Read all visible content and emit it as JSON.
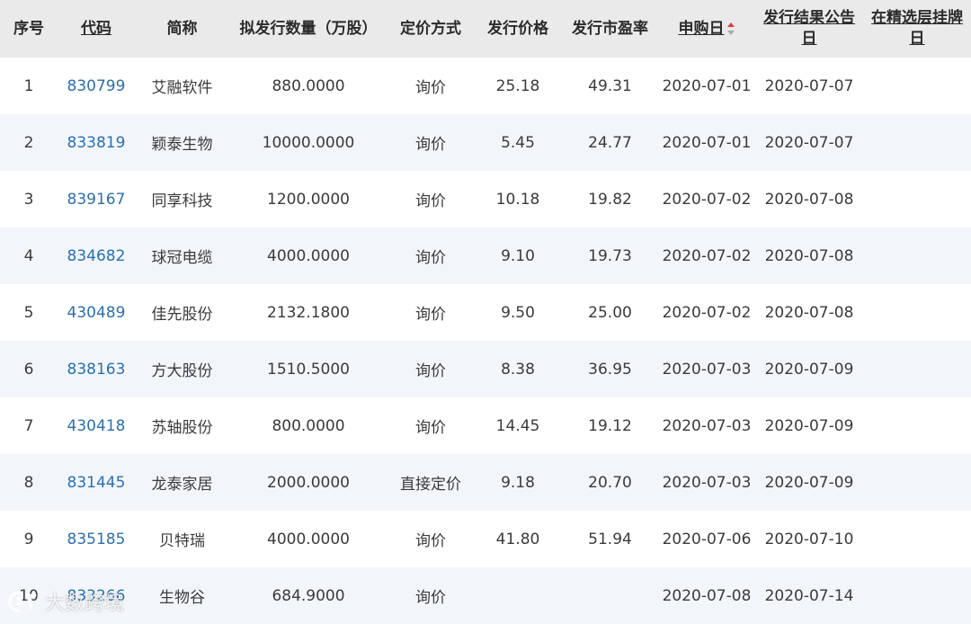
{
  "columns": {
    "seq": "序号",
    "code": "代码",
    "name": "简称",
    "quantity": "拟发行数量（万股）",
    "pricing_method": "定价方式",
    "price": "发行价格",
    "pe": "发行市盈率",
    "subscribe_date": "申购日",
    "result_date": "发行结果公告日",
    "listing_date": "在精选层挂牌日"
  },
  "sort": {
    "column": "subscribe_date",
    "direction": "ascending",
    "active_color": "#e03c3c",
    "inactive_color": "#aaaaaa"
  },
  "rows": [
    {
      "seq": "1",
      "code": "830799",
      "name": "艾融软件",
      "quantity": "880.0000",
      "method": "询价",
      "price": "25.18",
      "pe": "49.31",
      "subscribe": "2020-07-01",
      "result": "2020-07-07",
      "listing": ""
    },
    {
      "seq": "2",
      "code": "833819",
      "name": "颖泰生物",
      "quantity": "10000.0000",
      "method": "询价",
      "price": "5.45",
      "pe": "24.77",
      "subscribe": "2020-07-01",
      "result": "2020-07-07",
      "listing": ""
    },
    {
      "seq": "3",
      "code": "839167",
      "name": "同享科技",
      "quantity": "1200.0000",
      "method": "询价",
      "price": "10.18",
      "pe": "19.82",
      "subscribe": "2020-07-02",
      "result": "2020-07-08",
      "listing": ""
    },
    {
      "seq": "4",
      "code": "834682",
      "name": "球冠电缆",
      "quantity": "4000.0000",
      "method": "询价",
      "price": "9.10",
      "pe": "19.73",
      "subscribe": "2020-07-02",
      "result": "2020-07-08",
      "listing": ""
    },
    {
      "seq": "5",
      "code": "430489",
      "name": "佳先股份",
      "quantity": "2132.1800",
      "method": "询价",
      "price": "9.50",
      "pe": "25.00",
      "subscribe": "2020-07-02",
      "result": "2020-07-08",
      "listing": ""
    },
    {
      "seq": "6",
      "code": "838163",
      "name": "方大股份",
      "quantity": "1510.5000",
      "method": "询价",
      "price": "8.38",
      "pe": "36.95",
      "subscribe": "2020-07-03",
      "result": "2020-07-09",
      "listing": ""
    },
    {
      "seq": "7",
      "code": "430418",
      "name": "苏轴股份",
      "quantity": "800.0000",
      "method": "询价",
      "price": "14.45",
      "pe": "19.12",
      "subscribe": "2020-07-03",
      "result": "2020-07-09",
      "listing": ""
    },
    {
      "seq": "8",
      "code": "831445",
      "name": "龙泰家居",
      "quantity": "2000.0000",
      "method": "直接定价",
      "price": "9.18",
      "pe": "20.70",
      "subscribe": "2020-07-03",
      "result": "2020-07-09",
      "listing": ""
    },
    {
      "seq": "9",
      "code": "835185",
      "name": "贝特瑞",
      "quantity": "4000.0000",
      "method": "询价",
      "price": "41.80",
      "pe": "51.94",
      "subscribe": "2020-07-06",
      "result": "2020-07-10",
      "listing": ""
    },
    {
      "seq": "10",
      "code": "833266",
      "name": "生物谷",
      "quantity": "684.9000",
      "method": "询价",
      "price": "",
      "pe": "",
      "subscribe": "2020-07-08",
      "result": "2020-07-14",
      "listing": ""
    }
  ],
  "watermark": {
    "text": "大数跨境"
  }
}
